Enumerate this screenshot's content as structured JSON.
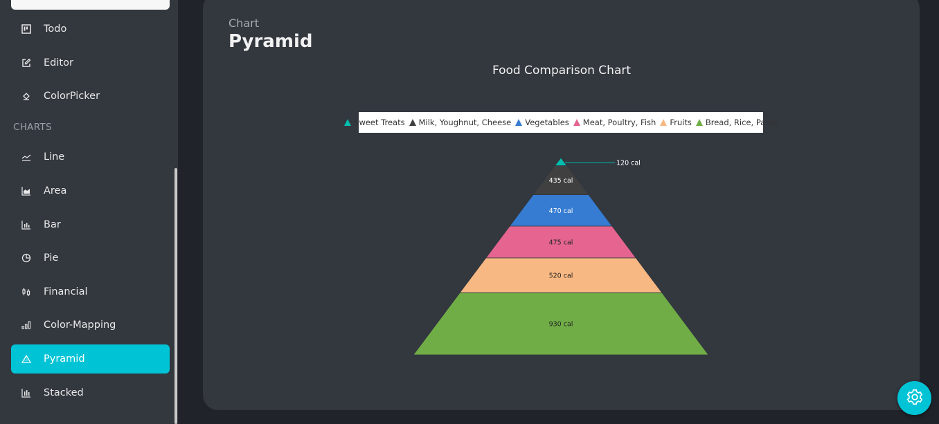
{
  "sidebar": {
    "items_top": [
      {
        "label": "Todo",
        "icon": "kanban-icon"
      },
      {
        "label": "Editor",
        "icon": "edit-icon"
      },
      {
        "label": "ColorPicker",
        "icon": "paint-bucket-icon"
      }
    ],
    "section_title": "CHARTS",
    "items_charts": [
      {
        "label": "Line",
        "icon": "line-chart-icon"
      },
      {
        "label": "Area",
        "icon": "area-chart-icon"
      },
      {
        "label": "Bar",
        "icon": "bar-chart-icon"
      },
      {
        "label": "Pie",
        "icon": "pie-chart-icon"
      },
      {
        "label": "Financial",
        "icon": "candlestick-icon"
      },
      {
        "label": "Color-Mapping",
        "icon": "color-mapping-icon"
      },
      {
        "label": "Pyramid",
        "icon": "pyramid-icon",
        "active": true
      },
      {
        "label": "Stacked",
        "icon": "stacked-chart-icon"
      }
    ],
    "accent_color": "#00c4d6"
  },
  "header": {
    "breadcrumb": "Chart",
    "title": "Pyramid"
  },
  "chart_data": {
    "type": "pyramid",
    "title": "Food Comparison Chart",
    "legend_position": "top",
    "series": [
      {
        "name": "Sweet Treats",
        "value": 120,
        "label": "120 cal",
        "color": "#00bdae"
      },
      {
        "name": "Milk, Youghnut, Cheese",
        "value": 435,
        "label": "435 cal",
        "color": "#404041"
      },
      {
        "name": "Vegetables",
        "value": 470,
        "label": "470 cal",
        "color": "#357cd2"
      },
      {
        "name": "Meat, Poultry, Fish",
        "value": 475,
        "label": "475 cal",
        "color": "#e56590"
      },
      {
        "name": "Fruits",
        "value": 520,
        "label": "520 cal",
        "color": "#f8b883"
      },
      {
        "name": "Bread, Rice, Pasta",
        "value": 930,
        "label": "930 cal",
        "color": "#70ad47"
      }
    ]
  },
  "settings": {
    "icon": "gear-icon"
  }
}
